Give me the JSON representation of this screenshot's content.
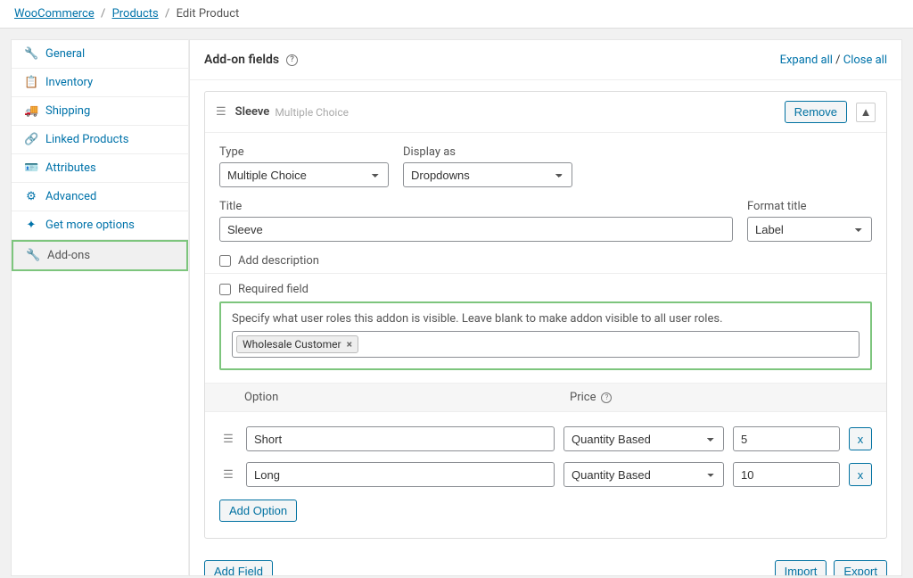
{
  "breadcrumb": {
    "woocommerce": "WooCommerce",
    "products": "Products",
    "current": "Edit Product"
  },
  "sidebar": {
    "items": [
      {
        "label": "General"
      },
      {
        "label": "Inventory"
      },
      {
        "label": "Shipping"
      },
      {
        "label": "Linked Products"
      },
      {
        "label": "Attributes"
      },
      {
        "label": "Advanced"
      },
      {
        "label": "Get more options"
      },
      {
        "label": "Add-ons"
      }
    ]
  },
  "header": {
    "title": "Add-on fields",
    "expand": "Expand all",
    "close": "Close all"
  },
  "panel": {
    "name": "Sleeve",
    "subtitle": "Multiple Choice",
    "remove": "Remove",
    "type_label": "Type",
    "type_value": "Multiple Choice",
    "display_label": "Display as",
    "display_value": "Dropdowns",
    "title_label": "Title",
    "title_value": "Sleeve",
    "format_label": "Format title",
    "format_value": "Label",
    "add_desc": "Add description",
    "required": "Required field",
    "roles_hint": "Specify what user roles this addon is visible. Leave blank to make addon visible to all user roles.",
    "role_tag": "Wholesale Customer",
    "option_label": "Option",
    "price_label": "Price",
    "options": [
      {
        "name": "Short",
        "pricetype": "Quantity Based",
        "price": "5"
      },
      {
        "name": "Long",
        "pricetype": "Quantity Based",
        "price": "10"
      }
    ],
    "add_option": "Add Option",
    "del": "x"
  },
  "bottom": {
    "add_field": "Add Field",
    "import": "Import",
    "export": "Export"
  }
}
